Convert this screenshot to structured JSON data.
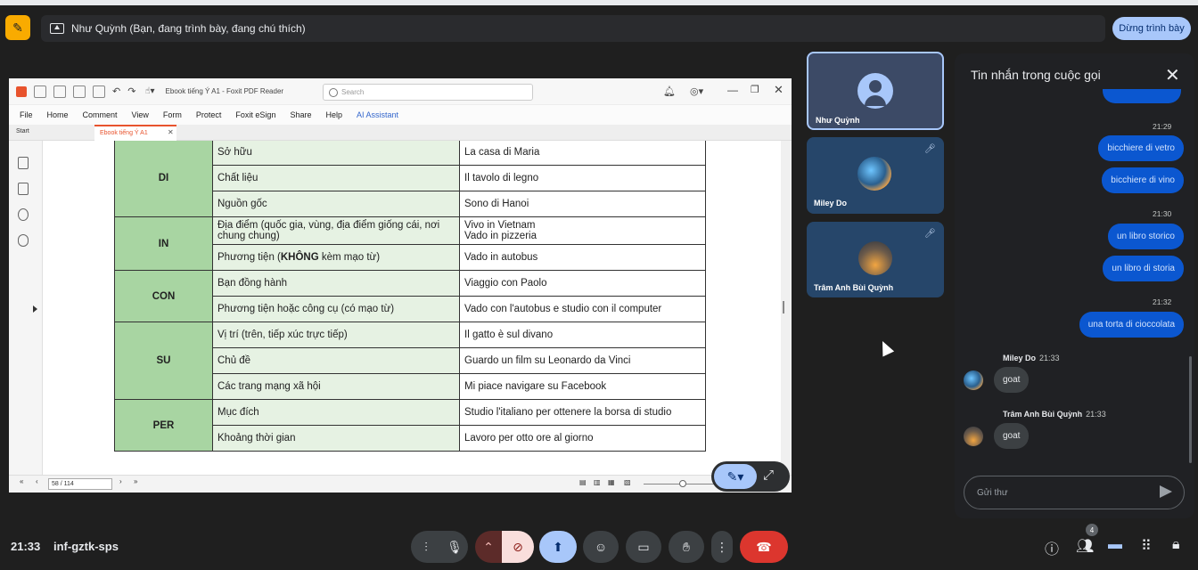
{
  "topbar": {
    "presenting_text": "Như Quỳnh (Bạn, đang trình bày, đang chú thích)",
    "stop_button": "Dừng trình bày"
  },
  "pdf": {
    "title": "Ebook tiếng Ý A1 - Foxit PDF Reader",
    "search_placeholder": "Search",
    "menu": [
      "File",
      "Home",
      "Comment",
      "View",
      "Form",
      "Protect",
      "Foxit eSign",
      "Share",
      "Help",
      "AI Assistant"
    ],
    "tab_start": "Start",
    "tab_doc": "Ebook tiếng Ý A1",
    "page_indicator": "58 / 114",
    "table": [
      {
        "prep": "DI",
        "rows": [
          {
            "use": "Sở hữu",
            "ex": "La casa di Maria"
          },
          {
            "use": "Chất liệu",
            "ex": "Il tavolo di legno"
          },
          {
            "use": "Nguồn gốc",
            "ex": "Sono di Hanoi"
          }
        ]
      },
      {
        "prep": "IN",
        "rows": [
          {
            "use": "Địa điểm (quốc gia, vùng, địa điểm giống cái, nơi chung chung)",
            "ex": "Vivo in Vietnam\nVado in pizzeria"
          },
          {
            "use_pre": "Phương tiện (",
            "use_bold": "KHÔNG",
            "use_post": " kèm mạo từ)",
            "ex": "Vado in autobus"
          }
        ]
      },
      {
        "prep": "CON",
        "rows": [
          {
            "use": "Bạn đồng hành",
            "ex": "Viaggio con Paolo"
          },
          {
            "use": "Phương tiện hoặc công cụ (có mạo từ)",
            "ex": "Vado con l'autobus e studio con il computer"
          }
        ]
      },
      {
        "prep": "SU",
        "rows": [
          {
            "use": "Vị trí (trên, tiếp xúc trực tiếp)",
            "ex": "Il gatto è sul divano"
          },
          {
            "use": "Chủ đề",
            "ex": "Guardo un film su Leonardo da Vinci"
          },
          {
            "use": "Các trang mạng xã hội",
            "ex": "Mi piace navigare su Facebook"
          }
        ]
      },
      {
        "prep": "PER",
        "rows": [
          {
            "use": "Mục đích",
            "ex": "Studio l'italiano per ottenere la borsa di studio"
          },
          {
            "use": "Khoảng thời gian",
            "ex": "Lavoro per otto ore al giorno"
          }
        ]
      }
    ]
  },
  "participants": [
    {
      "name": "Như Quỳnh"
    },
    {
      "name": "Miley Do"
    },
    {
      "name": "Trâm Anh Bùi Quỳnh"
    }
  ],
  "chat": {
    "title": "Tin nhắn trong cuộc gọi",
    "messages": [
      {
        "time": "21:29",
        "texts": [
          "bicchiere di vetro",
          "bicchiere di vino"
        ]
      },
      {
        "time": "21:30",
        "texts": [
          "un libro storico",
          "un libro di storia"
        ]
      },
      {
        "time": "21:32",
        "texts": [
          "una torta di cioccolata"
        ]
      }
    ],
    "incoming": [
      {
        "sender": "Miley Do",
        "time": "21:33",
        "text": "goat"
      },
      {
        "sender": "Trâm Anh Bùi Quỳnh",
        "time": "21:33",
        "text": "goat"
      }
    ],
    "input_placeholder": "Gửi thư"
  },
  "bottombar": {
    "time": "21:33",
    "meeting_code": "inf-gztk-sps",
    "people_count": "4"
  }
}
